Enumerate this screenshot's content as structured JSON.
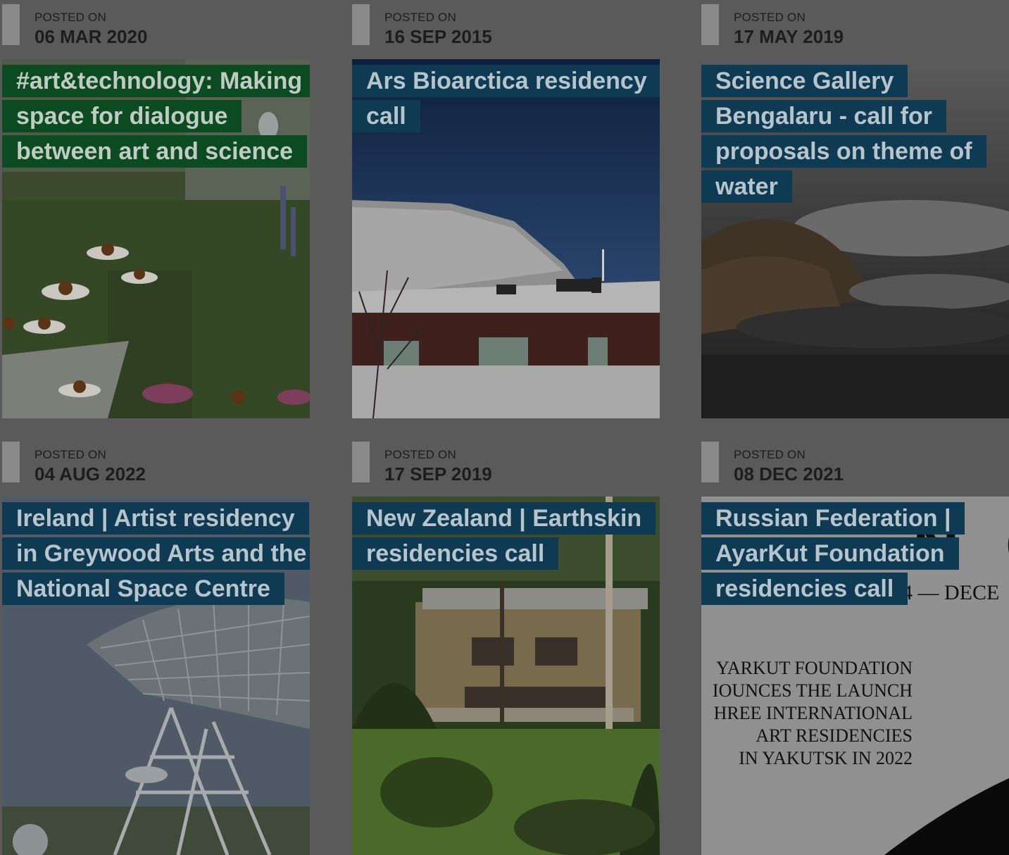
{
  "posts": [
    {
      "posted_label": "POSTED ON",
      "date": "06 MAR 2020",
      "title": "#art&technology: Making space for dialogue between art and science",
      "image": "flowers-garden",
      "title_bg": "#0c4a22"
    },
    {
      "posted_label": "POSTED ON",
      "date": "16 SEP 2015",
      "title": "Ars Bioarctica residency call",
      "image": "snow-house",
      "title_bg": "#0f3a53"
    },
    {
      "posted_label": "POSTED ON",
      "date": "17 MAY 2019",
      "title": "Science Gallery Bengalaru - call for proposals on theme of water",
      "image": "water-rocks",
      "title_bg": "#0f3a53"
    },
    {
      "posted_label": "POSTED ON",
      "date": "04 AUG 2022",
      "title": "Ireland | Artist residency in Greywood Arts and the National Space Centre",
      "image": "radio-telescope",
      "title_bg": "#0f3a53"
    },
    {
      "posted_label": "POSTED ON",
      "date": "17 SEP 2019",
      "title": "New Zealand | Earthskin residencies call",
      "image": "house-garden",
      "title_bg": "#0f3a53"
    },
    {
      "posted_label": "POSTED ON",
      "date": "08 DEC 2021",
      "title": "Russian Federation | AyarKut Foundation residencies call",
      "image": "poster",
      "poster": {
        "big_letters": "N C",
        "date_fragment": "14 — DECE",
        "lines": [
          "YARKUT FOUNDATION",
          "IOUNCES THE LAUNCH",
          "HREE INTERNATIONAL",
          "ART RESIDENCIES",
          "IN YAKUTSK IN 2022"
        ]
      },
      "title_bg": "#0f3a53"
    }
  ]
}
